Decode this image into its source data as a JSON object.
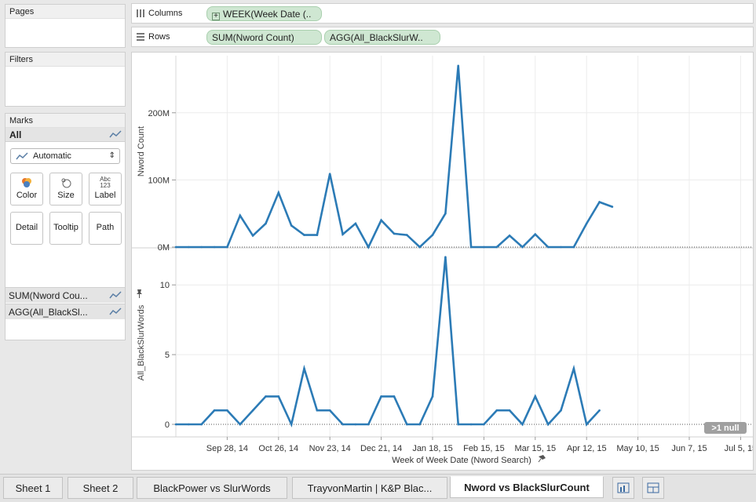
{
  "panes": {
    "pages_title": "Pages",
    "filters_title": "Filters",
    "marks_title": "Marks",
    "marks_all": "All",
    "mark_type": "Automatic",
    "buttons": {
      "color": "Color",
      "size": "Size",
      "label": "Label",
      "label_icon_text": "Abc\n123",
      "detail": "Detail",
      "tooltip": "Tooltip",
      "path": "Path"
    },
    "mark_fields": [
      "SUM(Nword Cou...",
      "AGG(All_BlackSl..."
    ]
  },
  "shelves": {
    "columns_label": "Columns",
    "rows_label": "Rows",
    "columns_pill": "WEEK(Week Date (..",
    "rows_pills": [
      "SUM(Nword Count)",
      "AGG(All_BlackSlurW.."
    ]
  },
  "colors": {
    "line": "#2c7bb6",
    "pill": "#cfe7d2",
    "null_badge": "#a0a0a0"
  },
  "chart_data": {
    "type": "line",
    "x_axis_title": "Week of Week Date (Nword Search)",
    "x_ticks": [
      "Sep 28, 14",
      "Oct 26, 14",
      "Nov 23, 14",
      "Dec 21, 14",
      "Jan 18, 15",
      "Feb 15, 15",
      "Mar 15, 15",
      "Apr 12, 15",
      "May 10, 15",
      "Jun 7, 15",
      "Jul 5, 15"
    ],
    "x_start_week": 0,
    "panes": [
      {
        "ylabel": "Nword Count",
        "y_ticks": [
          "0M",
          "100M",
          "200M"
        ],
        "y_tick_values": [
          0,
          100,
          200
        ],
        "ylim": [
          0,
          285
        ],
        "unit": "M",
        "values": [
          0,
          0,
          0,
          0,
          0,
          47,
          17,
          35,
          81,
          32,
          18,
          18,
          109,
          19,
          35,
          0,
          40,
          20,
          18,
          0,
          18,
          50,
          270,
          0,
          0,
          0,
          17,
          0,
          19,
          0,
          0,
          0,
          35,
          67,
          60
        ]
      },
      {
        "ylabel": "All_BlackSlurWords",
        "y_ticks": [
          "0",
          "5",
          "10"
        ],
        "y_tick_values": [
          0,
          5,
          10
        ],
        "ylim": [
          -0.9,
          12.6
        ],
        "unit": "",
        "values": [
          0,
          0,
          0,
          1,
          1,
          0,
          1,
          2,
          2,
          0,
          4,
          1,
          1,
          0,
          0,
          0,
          2,
          2,
          0,
          0,
          2,
          12,
          0,
          0,
          0,
          1,
          1,
          0,
          2,
          0,
          1,
          4,
          0,
          1
        ]
      }
    ],
    "null_indicator": ">1 null"
  },
  "tabs": [
    "Sheet 1",
    "Sheet 2",
    "BlackPower vs SlurWords",
    "TrayvonMartin | K&P Blac...",
    "Nword vs BlackSlurCount"
  ],
  "active_tab": 4
}
